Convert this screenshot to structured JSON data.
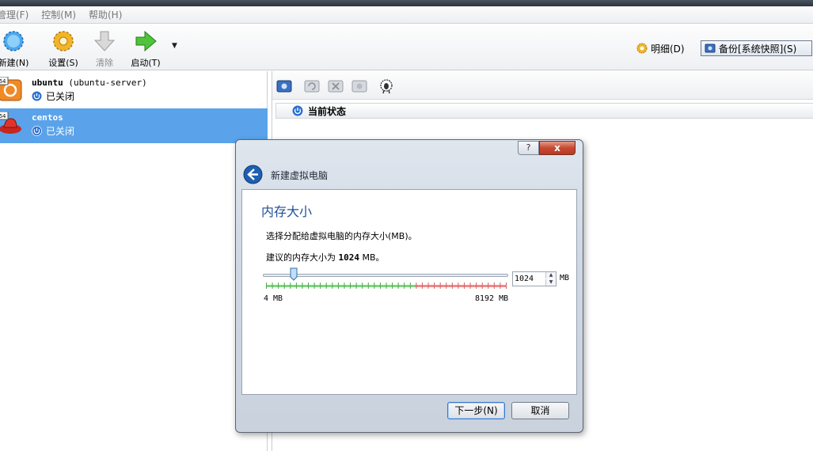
{
  "menubar": {
    "items": [
      {
        "label": "管理(F)"
      },
      {
        "label": "控制(M)"
      },
      {
        "label": "帮助(H)"
      }
    ]
  },
  "toolbar": {
    "new_label": "新建(N)",
    "settings_label": "设置(S)",
    "discard_label": "清除",
    "start_label": "启动(T)",
    "details_label": "明细(D)",
    "snapshots_label": "备份[系统快照](S)"
  },
  "vms": [
    {
      "name": "ubuntu",
      "os": "(ubuntu-server)",
      "state": "已关闭",
      "arch": "64"
    },
    {
      "name": "centos",
      "os": "",
      "state": "已关闭",
      "arch": "64"
    }
  ],
  "snapshots": {
    "current_state": "当前状态"
  },
  "dialog": {
    "help": "?",
    "close": "x",
    "title": "新建虚拟电脑",
    "heading": "内存大小",
    "desc1": "选择分配给虚拟电脑的内存大小(MB)。",
    "desc2_prefix": "建议的内存大小为",
    "desc2_value": "1024",
    "desc2_suffix": "MB。",
    "memory": {
      "value": "1024",
      "unit": "MB",
      "min_label": "4 MB",
      "max_label": "8192 MB",
      "min_mb": 4,
      "max_mb": 8192,
      "current_mb": 1024
    },
    "next_label": "下一步(N)",
    "cancel_label": "取消"
  },
  "colors": {
    "selection": "#5aa3ea",
    "heading_blue": "#1f4f9a",
    "slider_green": "#7dd67d",
    "slider_red": "#ee8a8a"
  }
}
